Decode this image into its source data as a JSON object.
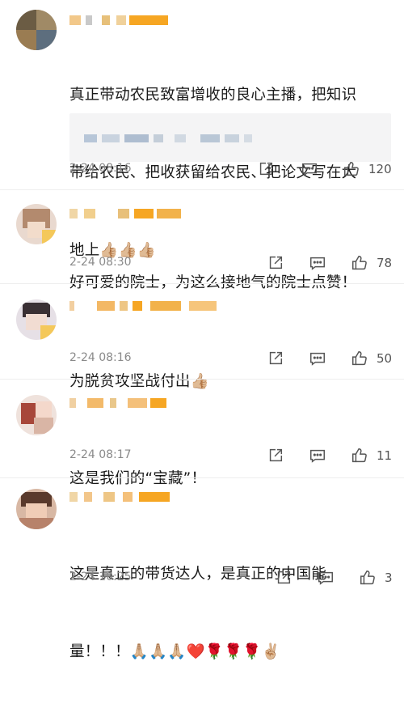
{
  "comments": [
    {
      "text_lines": [
        "真正带动农民致富增收的良心主播，把知识",
        "带给农民、把收获留给农民、把论文写在大",
        "地上👍🏼👍🏼👍🏼"
      ],
      "timestamp": "2-24 08:16",
      "likes": "120",
      "has_quote": true
    },
    {
      "text_lines": [
        "好可爱的院士，为这么接地气的院士点赞！"
      ],
      "timestamp": "2-24 08:30",
      "likes": "78",
      "has_quote": false
    },
    {
      "text_lines": [
        "为脱贫攻坚战付出👍🏼"
      ],
      "timestamp": "2-24 08:16",
      "likes": "50",
      "has_quote": false
    },
    {
      "text_lines": [
        "这是我们的“宝藏”！"
      ],
      "timestamp": "2-24 08:17",
      "likes": "11",
      "has_quote": false
    },
    {
      "text_lines": [
        "这是真正的带货达人，是真正的中国能",
        "量！！！🙏🏼🙏🏼🙏🏼❤️🌹🌹🌹✌🏼"
      ],
      "timestamp": "2-24 10:25",
      "likes": "3",
      "has_quote": false
    }
  ],
  "icons": {
    "share": "share-icon",
    "reply": "reply-icon",
    "like": "thumbs-up-icon"
  },
  "colors": {
    "accent": "#f6a623",
    "meta_text": "#8a8a8a",
    "quote_bg": "#f4f4f5"
  }
}
